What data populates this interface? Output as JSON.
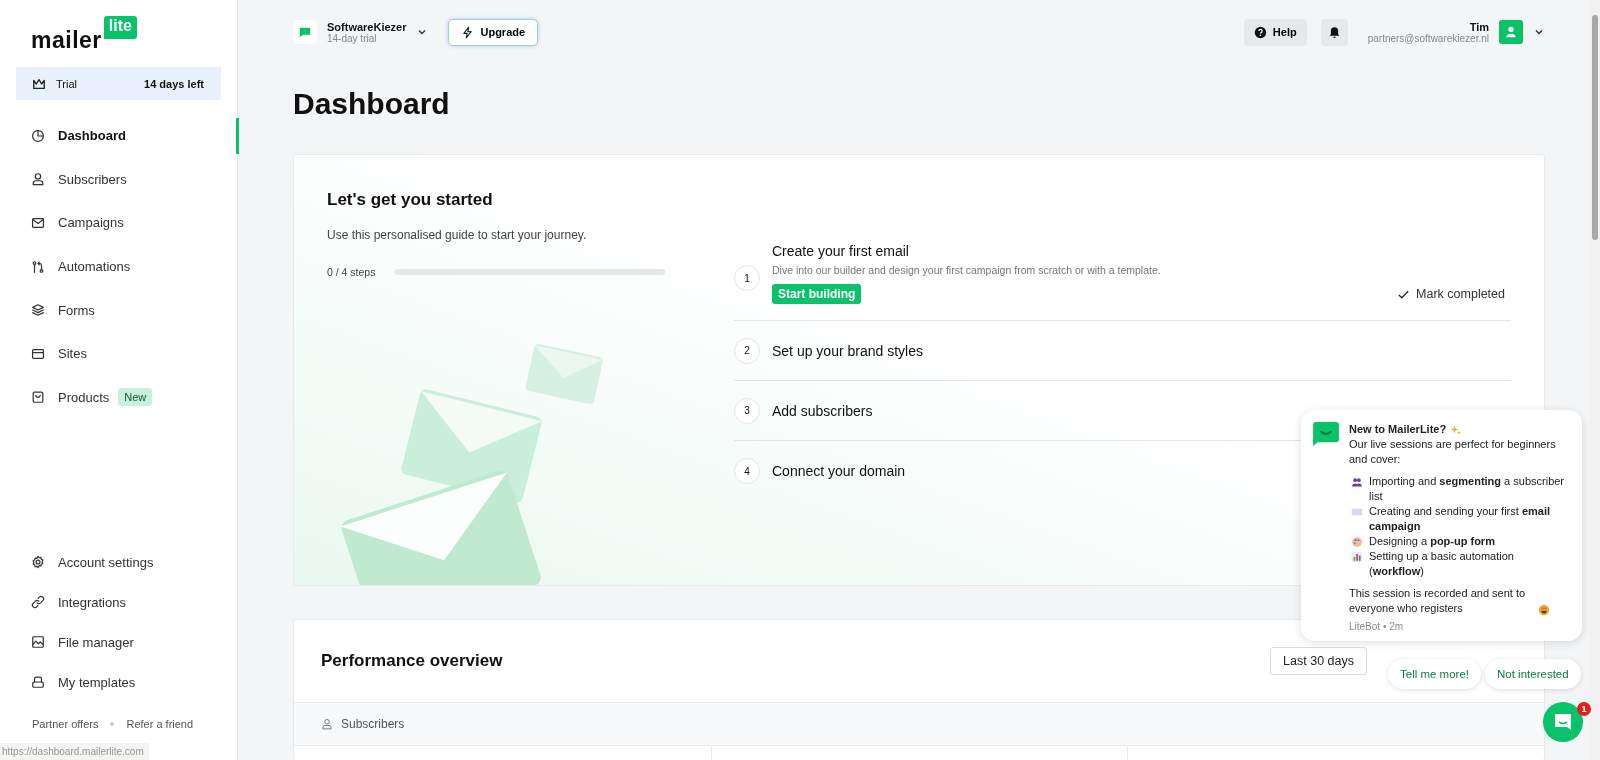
{
  "sidebar": {
    "logo": {
      "word": "mailer",
      "badge": "lite"
    },
    "trial": {
      "label": "Trial",
      "remaining": "14 days left"
    },
    "items": [
      {
        "label": "Dashboard",
        "selected": true
      },
      {
        "label": "Subscribers",
        "selected": false
      },
      {
        "label": "Campaigns",
        "selected": false
      },
      {
        "label": "Automations",
        "selected": false
      },
      {
        "label": "Forms",
        "selected": false
      },
      {
        "label": "Sites",
        "selected": false
      },
      {
        "label": "Products",
        "selected": false,
        "badge": "New"
      }
    ],
    "bottom_items": [
      {
        "label": "Account settings"
      },
      {
        "label": "Integrations"
      },
      {
        "label": "File manager"
      },
      {
        "label": "My templates"
      }
    ],
    "footer_links": [
      "Partner offers",
      "Refer a friend"
    ]
  },
  "header": {
    "account": {
      "name": "SoftwareKiezer",
      "plan": "14-day trial"
    },
    "upgrade": "Upgrade",
    "help": "Help",
    "user": {
      "name": "Tim",
      "email": "partners@softwarekiezer.nl"
    }
  },
  "page_title": "Dashboard",
  "guide": {
    "title": "Let's get you started",
    "subtitle": "Use this personalised guide to start your journey.",
    "progress_label": "0 / 4 steps",
    "level": 0,
    "steps": [
      {
        "number": "1",
        "title": "Create your first email",
        "description": "Dive into our builder and design your first campaign from scratch or with a template.",
        "action": "Start building",
        "mark": "Mark completed"
      },
      {
        "number": "2",
        "title": "Set up your brand styles"
      },
      {
        "number": "3",
        "title": "Add subscribers"
      },
      {
        "number": "4",
        "title": "Connect your domain"
      }
    ]
  },
  "performance": {
    "title": "Performance overview",
    "range": "Last 30 days",
    "tab": "Subscribers"
  },
  "chat": {
    "intro_bold": "New to MailerLite?",
    "intro": "Our live sessions are perfect for beginners and cover:",
    "items": [
      "Importing and **segmenting** a subscriber list",
      "Creating and sending your first **email campaign**",
      "Designing a **pop-up form**",
      "Setting up a basic automation (**workflow**)"
    ],
    "closing": "This session is recorded and sent to everyone who registers",
    "meta": "LiteBot • 2m",
    "replies": [
      "Tell me more!",
      "Not interested"
    ],
    "unread": "1"
  },
  "status_url": "https://dashboard.mailerlite.com"
}
